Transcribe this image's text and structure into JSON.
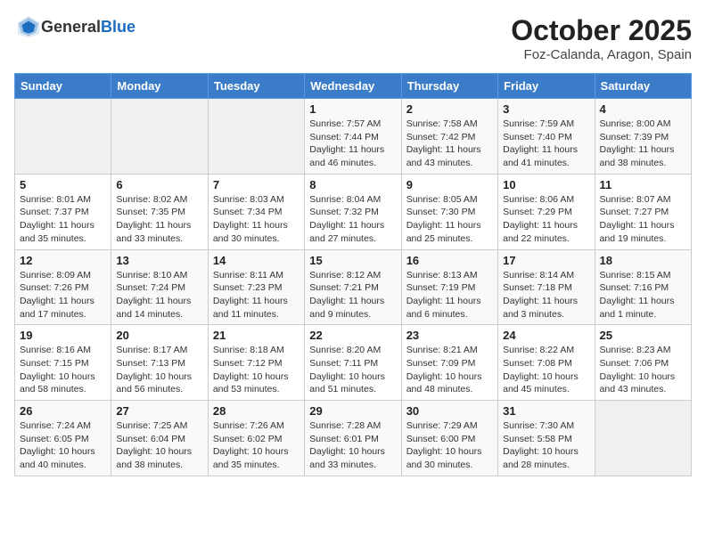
{
  "header": {
    "logo_general": "General",
    "logo_blue": "Blue",
    "month": "October 2025",
    "location": "Foz-Calanda, Aragon, Spain"
  },
  "weekdays": [
    "Sunday",
    "Monday",
    "Tuesday",
    "Wednesday",
    "Thursday",
    "Friday",
    "Saturday"
  ],
  "weeks": [
    [
      {
        "day": "",
        "info": ""
      },
      {
        "day": "",
        "info": ""
      },
      {
        "day": "",
        "info": ""
      },
      {
        "day": "1",
        "info": "Sunrise: 7:57 AM\nSunset: 7:44 PM\nDaylight: 11 hours and 46 minutes."
      },
      {
        "day": "2",
        "info": "Sunrise: 7:58 AM\nSunset: 7:42 PM\nDaylight: 11 hours and 43 minutes."
      },
      {
        "day": "3",
        "info": "Sunrise: 7:59 AM\nSunset: 7:40 PM\nDaylight: 11 hours and 41 minutes."
      },
      {
        "day": "4",
        "info": "Sunrise: 8:00 AM\nSunset: 7:39 PM\nDaylight: 11 hours and 38 minutes."
      }
    ],
    [
      {
        "day": "5",
        "info": "Sunrise: 8:01 AM\nSunset: 7:37 PM\nDaylight: 11 hours and 35 minutes."
      },
      {
        "day": "6",
        "info": "Sunrise: 8:02 AM\nSunset: 7:35 PM\nDaylight: 11 hours and 33 minutes."
      },
      {
        "day": "7",
        "info": "Sunrise: 8:03 AM\nSunset: 7:34 PM\nDaylight: 11 hours and 30 minutes."
      },
      {
        "day": "8",
        "info": "Sunrise: 8:04 AM\nSunset: 7:32 PM\nDaylight: 11 hours and 27 minutes."
      },
      {
        "day": "9",
        "info": "Sunrise: 8:05 AM\nSunset: 7:30 PM\nDaylight: 11 hours and 25 minutes."
      },
      {
        "day": "10",
        "info": "Sunrise: 8:06 AM\nSunset: 7:29 PM\nDaylight: 11 hours and 22 minutes."
      },
      {
        "day": "11",
        "info": "Sunrise: 8:07 AM\nSunset: 7:27 PM\nDaylight: 11 hours and 19 minutes."
      }
    ],
    [
      {
        "day": "12",
        "info": "Sunrise: 8:09 AM\nSunset: 7:26 PM\nDaylight: 11 hours and 17 minutes."
      },
      {
        "day": "13",
        "info": "Sunrise: 8:10 AM\nSunset: 7:24 PM\nDaylight: 11 hours and 14 minutes."
      },
      {
        "day": "14",
        "info": "Sunrise: 8:11 AM\nSunset: 7:23 PM\nDaylight: 11 hours and 11 minutes."
      },
      {
        "day": "15",
        "info": "Sunrise: 8:12 AM\nSunset: 7:21 PM\nDaylight: 11 hours and 9 minutes."
      },
      {
        "day": "16",
        "info": "Sunrise: 8:13 AM\nSunset: 7:19 PM\nDaylight: 11 hours and 6 minutes."
      },
      {
        "day": "17",
        "info": "Sunrise: 8:14 AM\nSunset: 7:18 PM\nDaylight: 11 hours and 3 minutes."
      },
      {
        "day": "18",
        "info": "Sunrise: 8:15 AM\nSunset: 7:16 PM\nDaylight: 11 hours and 1 minute."
      }
    ],
    [
      {
        "day": "19",
        "info": "Sunrise: 8:16 AM\nSunset: 7:15 PM\nDaylight: 10 hours and 58 minutes."
      },
      {
        "day": "20",
        "info": "Sunrise: 8:17 AM\nSunset: 7:13 PM\nDaylight: 10 hours and 56 minutes."
      },
      {
        "day": "21",
        "info": "Sunrise: 8:18 AM\nSunset: 7:12 PM\nDaylight: 10 hours and 53 minutes."
      },
      {
        "day": "22",
        "info": "Sunrise: 8:20 AM\nSunset: 7:11 PM\nDaylight: 10 hours and 51 minutes."
      },
      {
        "day": "23",
        "info": "Sunrise: 8:21 AM\nSunset: 7:09 PM\nDaylight: 10 hours and 48 minutes."
      },
      {
        "day": "24",
        "info": "Sunrise: 8:22 AM\nSunset: 7:08 PM\nDaylight: 10 hours and 45 minutes."
      },
      {
        "day": "25",
        "info": "Sunrise: 8:23 AM\nSunset: 7:06 PM\nDaylight: 10 hours and 43 minutes."
      }
    ],
    [
      {
        "day": "26",
        "info": "Sunrise: 7:24 AM\nSunset: 6:05 PM\nDaylight: 10 hours and 40 minutes."
      },
      {
        "day": "27",
        "info": "Sunrise: 7:25 AM\nSunset: 6:04 PM\nDaylight: 10 hours and 38 minutes."
      },
      {
        "day": "28",
        "info": "Sunrise: 7:26 AM\nSunset: 6:02 PM\nDaylight: 10 hours and 35 minutes."
      },
      {
        "day": "29",
        "info": "Sunrise: 7:28 AM\nSunset: 6:01 PM\nDaylight: 10 hours and 33 minutes."
      },
      {
        "day": "30",
        "info": "Sunrise: 7:29 AM\nSunset: 6:00 PM\nDaylight: 10 hours and 30 minutes."
      },
      {
        "day": "31",
        "info": "Sunrise: 7:30 AM\nSunset: 5:58 PM\nDaylight: 10 hours and 28 minutes."
      },
      {
        "day": "",
        "info": ""
      }
    ]
  ]
}
